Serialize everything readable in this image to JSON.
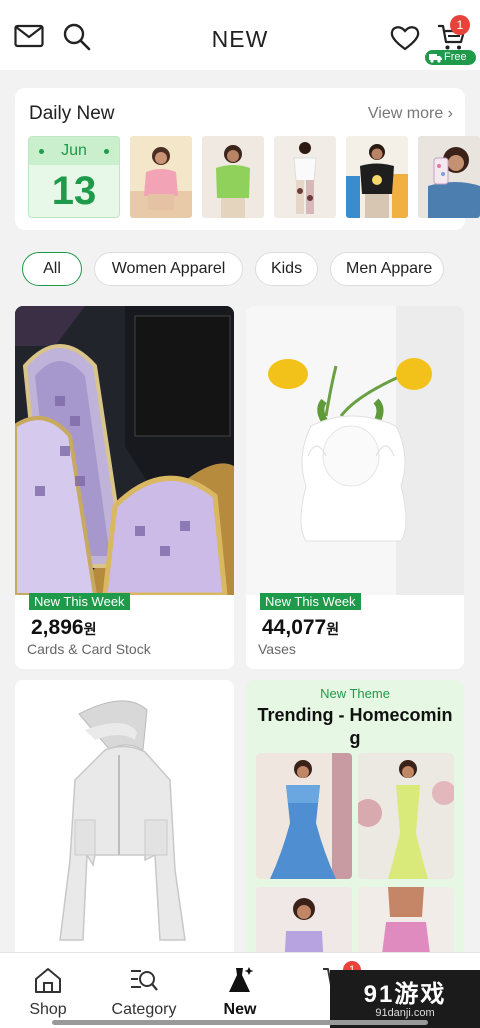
{
  "header": {
    "title": "NEW",
    "cart_count": "1",
    "free_label": "Free"
  },
  "daily_new": {
    "title": "Daily New",
    "view_more": "View more",
    "month": "Jun",
    "day": "13"
  },
  "chips": [
    {
      "label": "All"
    },
    {
      "label": "Women Apparel"
    },
    {
      "label": "Kids"
    },
    {
      "label": "Men Appare"
    }
  ],
  "products": [
    {
      "tag": "New This Week",
      "price": "2,896",
      "currency": "원",
      "category": "Cards & Card Stock"
    },
    {
      "tag": "New This Week",
      "price": "44,077",
      "currency": "원",
      "category": "Vases"
    }
  ],
  "theme": {
    "label": "New Theme",
    "title": "Trending - Homecoming"
  },
  "bottom_nav": {
    "items": [
      {
        "label": "Shop"
      },
      {
        "label": "Category"
      },
      {
        "label": "New"
      }
    ],
    "cart_count": "1"
  },
  "watermark": {
    "logo": "91游戏",
    "url": "91danji.com"
  }
}
